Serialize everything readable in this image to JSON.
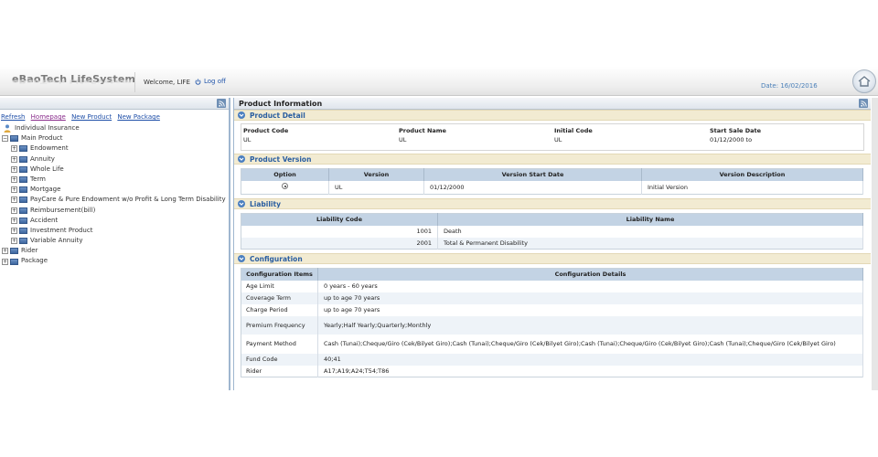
{
  "header": {
    "app_title": "eBaoTech LifeSystem",
    "welcome": "Welcome, LIFE",
    "logoff": "Log off",
    "date": "Date: 16/02/2016"
  },
  "left": {
    "links": [
      "Refresh",
      "Homepage",
      "New Product",
      "New Package"
    ],
    "tree_root": "Individual Insurance",
    "main_product": "Main Product",
    "categories": [
      "Endowment",
      "Annuity",
      "Whole Life",
      "Term",
      "Mortgage",
      "PayCare & Pure Endowment w/o Profit & Long Term Disability",
      "Reimbursement(bill)",
      "Accident",
      "Investment Product",
      "Variable Annuity"
    ],
    "rider": "Rider",
    "package": "Package"
  },
  "panel": {
    "title": "Product Information"
  },
  "product_detail": {
    "section": "Product Detail",
    "fields": [
      {
        "label": "Product Code",
        "value": "UL"
      },
      {
        "label": "Product Name",
        "value": "UL"
      },
      {
        "label": "Initial Code",
        "value": "UL"
      },
      {
        "label": "Start Sale Date",
        "value": "01/12/2000 to"
      }
    ]
  },
  "product_version": {
    "section": "Product Version",
    "headers": [
      "Option",
      "Version",
      "Version Start Date",
      "Version Description"
    ],
    "rows": [
      {
        "version": "UL",
        "start_date": "01/12/2000",
        "description": "Initial Version"
      }
    ]
  },
  "liability": {
    "section": "Liability",
    "headers": [
      "Liability Code",
      "Liability Name"
    ],
    "rows": [
      {
        "code": "1001",
        "name": "Death"
      },
      {
        "code": "2001",
        "name": "Total & Permanent Disability"
      }
    ]
  },
  "configuration": {
    "section": "Configuration",
    "headers": [
      "Configuration Items",
      "Configuration Details"
    ],
    "rows": [
      {
        "item": "Age Limit",
        "detail": "0 years - 60 years"
      },
      {
        "item": "Coverage Term",
        "detail": "up to age 70 years"
      },
      {
        "item": "Charge Period",
        "detail": "up to age 70 years"
      },
      {
        "item": "Premium Frequency",
        "detail": "Yearly;Half Yearly;Quarterly;Monthly"
      },
      {
        "item": "Payment Method",
        "detail": "Cash (Tunai);Cheque/Giro (Cek/Bilyet Giro);Cash (Tunai);Cheque/Giro (Cek/Bilyet Giro);Cash (Tunai);Cheque/Giro (Cek/Bilyet Giro);Cash (Tunai);Cheque/Giro (Cek/Bilyet Giro)"
      },
      {
        "item": "Fund Code",
        "detail": "40;41"
      },
      {
        "item": "Rider",
        "detail": "A17;A19;A24;T54;T86"
      }
    ]
  }
}
